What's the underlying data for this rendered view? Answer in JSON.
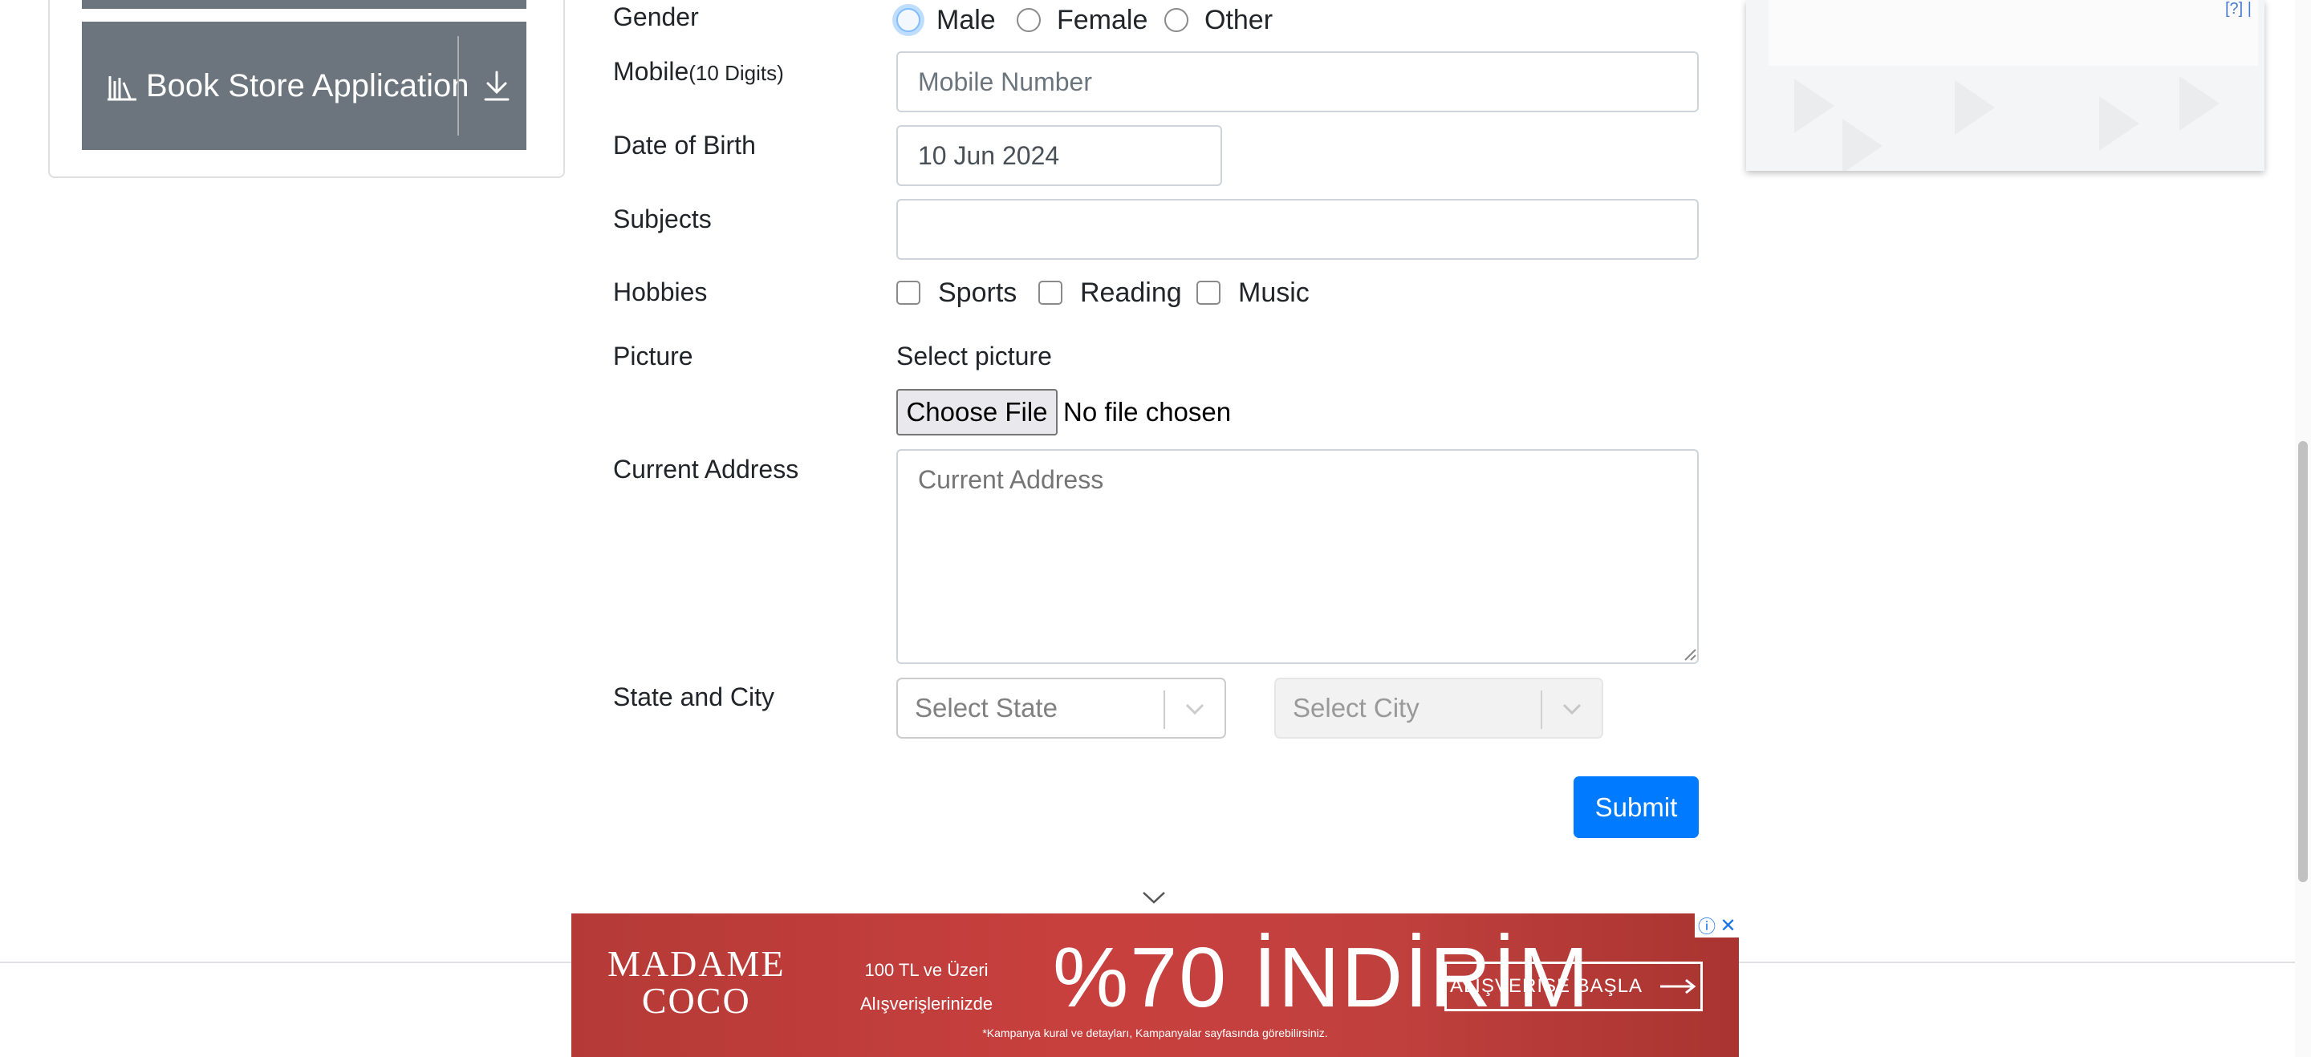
{
  "sidebar": {
    "book_store_label": "Book Store Application"
  },
  "form": {
    "gender": {
      "label": "Gender",
      "options": [
        "Male",
        "Female",
        "Other"
      ]
    },
    "mobile": {
      "label": "Mobile",
      "hint": "(10 Digits)",
      "placeholder": "Mobile Number"
    },
    "dob": {
      "label": "Date of Birth",
      "value": "10 Jun 2024"
    },
    "subjects": {
      "label": "Subjects",
      "value": ""
    },
    "hobbies": {
      "label": "Hobbies",
      "options": [
        "Sports",
        "Reading",
        "Music"
      ]
    },
    "picture": {
      "label": "Picture",
      "caption": "Select picture",
      "button": "Choose File",
      "status": "No file chosen"
    },
    "address": {
      "label": "Current Address",
      "placeholder": "Current Address"
    },
    "state_city": {
      "label": "State and City",
      "state_placeholder": "Select State",
      "city_placeholder": "Select City"
    },
    "submit_label": "Submit"
  },
  "top_ad": {
    "adchoices": "[?] |"
  },
  "bottom_ad": {
    "brand_line1": "MADAME",
    "brand_line2": "COCO",
    "tag_line1": "100 TL ve Üzeri",
    "tag_line2": "Alışverişlerinizde",
    "promo": "%70 İNDİRİM",
    "cta": "ALIŞVERİŞE BAŞLA",
    "fine_print": "*Kampanya kural ve detayları, Kampanyalar sayfasında görebilirsiniz.",
    "info_symbol": "ⓘ",
    "close_symbol": "✕"
  },
  "colors": {
    "primary": "#007bff",
    "sidebar_button": "#6c757d",
    "ad_red": "#c0403d"
  }
}
